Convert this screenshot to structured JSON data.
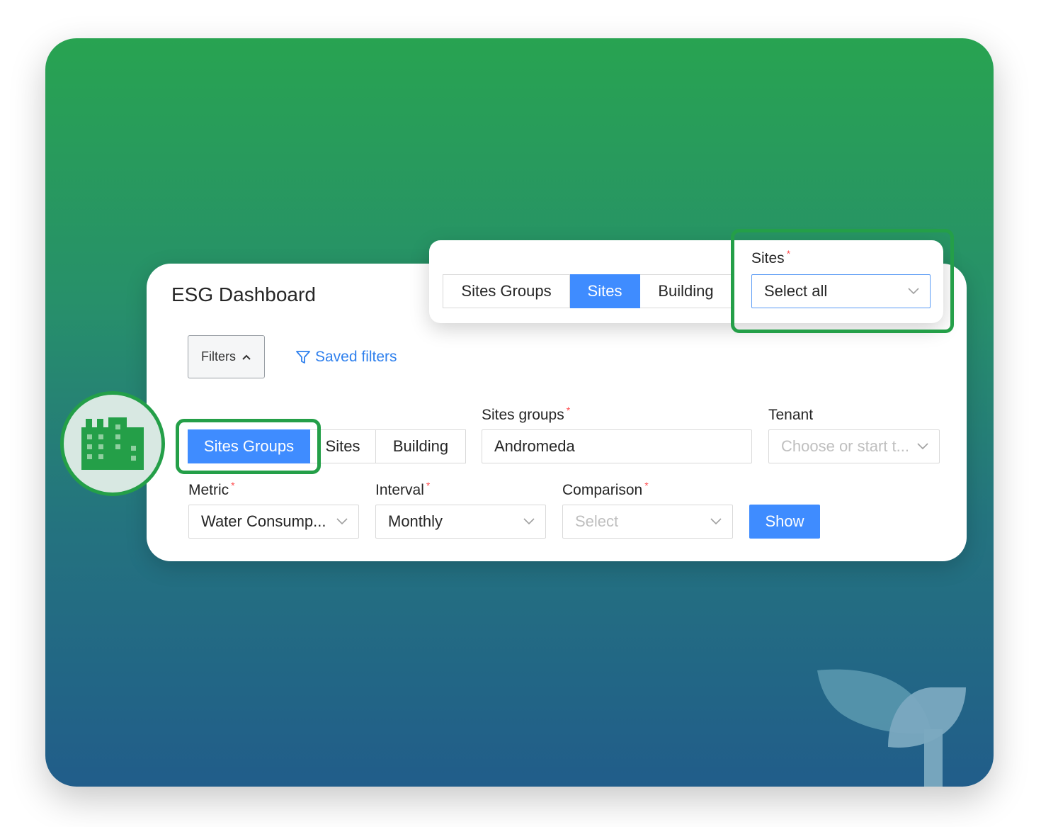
{
  "app": {
    "title": "ESG Dashboard"
  },
  "toolbar": {
    "filters_label": "Filters",
    "saved_filters_label": "Saved filters"
  },
  "scope_toggle": {
    "items": [
      "Sites Groups",
      "Sites",
      "Building"
    ],
    "selected": "Sites Groups"
  },
  "sites_groups_field": {
    "label": "Sites groups",
    "required_mark": "*",
    "value": "Andromeda"
  },
  "tenant_field": {
    "label": "Tenant",
    "placeholder": "Choose or start t..."
  },
  "metric_field": {
    "label": "Metric",
    "required_mark": "*",
    "value": "Water Consump..."
  },
  "interval_field": {
    "label": "Interval",
    "required_mark": "*",
    "value": "Monthly"
  },
  "comparison_field": {
    "label": "Comparison",
    "required_mark": "*",
    "placeholder": "Select"
  },
  "show_button": {
    "label": "Show"
  },
  "popup": {
    "toggle_items": [
      "Sites Groups",
      "Sites",
      "Building"
    ],
    "selected": "Sites",
    "sites_label": "Sites",
    "required_mark": "*",
    "sites_value": "Select all"
  },
  "icons": {
    "feature_icon": "building-icon",
    "saved_filters_icon": "filter-funnel-icon",
    "filters_toggle_icon": "chevron-up-icon",
    "dropdown_icon": "chevron-down-icon",
    "decoration": "leaf-sprout-icon"
  },
  "colors": {
    "accent_blue": "#3f8cff",
    "highlight_green": "#249f48",
    "gradient_top": "#28a351",
    "gradient_bottom": "#215d8a",
    "required_red": "#ff4d4f"
  }
}
